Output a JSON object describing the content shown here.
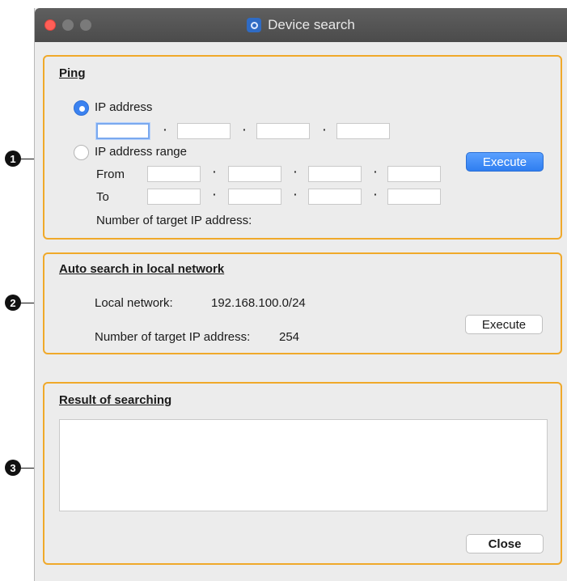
{
  "window": {
    "title": "Device search"
  },
  "callouts": [
    "1",
    "2",
    "3"
  ],
  "ping": {
    "heading": "Ping",
    "ip_address_label": "IP address",
    "ip_range_label": "IP address range",
    "from_label": "From",
    "to_label": "To",
    "target_count_label": "Number of target IP address:",
    "execute_label": "Execute",
    "separator": "·"
  },
  "auto_search": {
    "heading": "Auto search in local network",
    "local_network_label": "Local network:",
    "local_network_value": "192.168.100.0/24",
    "target_count_label": "Number of target IP address:",
    "target_count_value": "254",
    "execute_label": "Execute"
  },
  "result": {
    "heading": "Result of searching",
    "close_label": "Close"
  }
}
